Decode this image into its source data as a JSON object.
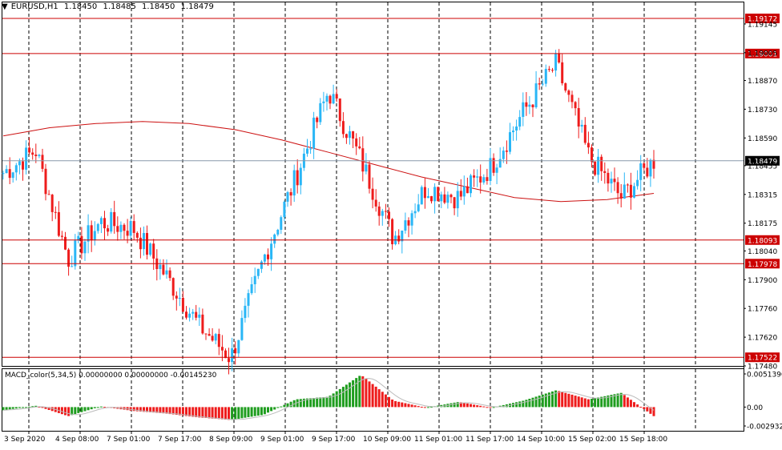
{
  "header": {
    "collapse_glyph": "▼",
    "symbol": "EURUSD,H1",
    "open": "1.18450",
    "high": "1.18485",
    "low": "1.18450",
    "close": "1.18479"
  },
  "macd_header": "MACD_color(5,34,5) 0.00000000 0.00000000 -0.00145230",
  "price_scale": {
    "ticks": [
      "1.19145",
      "1.19005",
      "1.18870",
      "1.18730",
      "1.18590",
      "1.18455",
      "1.18315",
      "1.18175",
      "1.18040",
      "1.17900",
      "1.17760",
      "1.17620",
      "1.17480"
    ]
  },
  "levels": [
    {
      "label": "1.19172",
      "price": 1.19172
    },
    {
      "label": "1.19001",
      "price": 1.19001
    },
    {
      "label": "1.18093",
      "price": 1.18093
    },
    {
      "label": "1.17978",
      "price": 1.17978
    },
    {
      "label": "1.17522",
      "price": 1.17522
    }
  ],
  "current_price": {
    "label": "1.18479",
    "price": 1.18479
  },
  "macd_scale": {
    "ticks": [
      "0.0051390",
      "0.00",
      "-0.002932"
    ]
  },
  "time_axis": {
    "labels": [
      "3 Sep 2020",
      "4 Sep 08:00",
      "7 Sep 01:00",
      "7 Sep 17:00",
      "8 Sep 09:00",
      "9 Sep 01:00",
      "9 Sep 17:00",
      "10 Sep 09:00",
      "11 Sep 01:00",
      "11 Sep 17:00",
      "14 Sep 10:00",
      "15 Sep 02:00",
      "15 Sep 18:00"
    ]
  },
  "colors": {
    "bull": "#29b6f6",
    "bear": "#ee1c1c",
    "level": "#cc0000",
    "ma": "#cc1111",
    "current": "#8899aa",
    "grid": "#000000",
    "macd_pos": "#1f9d1f",
    "macd_neg": "#ee1c1c",
    "signal": "#bbbbbb"
  },
  "chart_data": [
    {
      "type": "candlestick",
      "title": "EURUSD,H1",
      "ylim": [
        1.1748,
        1.1925
      ],
      "x": [
        "3 Sep 2020",
        "4 Sep 08:00",
        "7 Sep 01:00",
        "7 Sep 17:00",
        "8 Sep 09:00",
        "9 Sep 01:00",
        "9 Sep 17:00",
        "10 Sep 09:00",
        "11 Sep 01:00",
        "11 Sep 17:00",
        "14 Sep 10:00",
        "15 Sep 02:00",
        "15 Sep 18:00"
      ],
      "series": [
        {
          "close": [
            1.1842,
            1.1853,
            1.18,
            1.1818,
            1.1815,
            1.1792,
            1.1768,
            1.1752,
            1.18,
            1.184,
            1.1882,
            1.1848,
            1.181,
            1.1835,
            1.183,
            1.1845,
            1.1872,
            1.1895,
            1.185,
            1.183,
            1.1848
          ]
        },
        {
          "moving_average": [
            1.186,
            1.1864,
            1.1866,
            1.1867,
            1.1866,
            1.1863,
            1.1858,
            1.1852,
            1.1846,
            1.184,
            1.1835,
            1.183,
            1.1828,
            1.1829,
            1.1832
          ]
        }
      ],
      "horizontal_levels": [
        1.19172,
        1.19001,
        1.18093,
        1.17978,
        1.17522
      ],
      "current": 1.18479,
      "grid": true
    },
    {
      "type": "bar",
      "title": "MACD_color(5,34,5)",
      "ylim": [
        -0.002932,
        0.005139
      ],
      "values": [
        -0.0005,
        0.0002,
        -0.0014,
        0.0001,
        -0.0006,
        -0.001,
        -0.0016,
        -0.002,
        -0.0012,
        0.0012,
        0.0016,
        0.005,
        0.001,
        -0.0001,
        0.0008,
        -0.0001,
        0.001,
        0.0026,
        0.0012,
        0.0022,
        -0.0014
      ]
    }
  ]
}
